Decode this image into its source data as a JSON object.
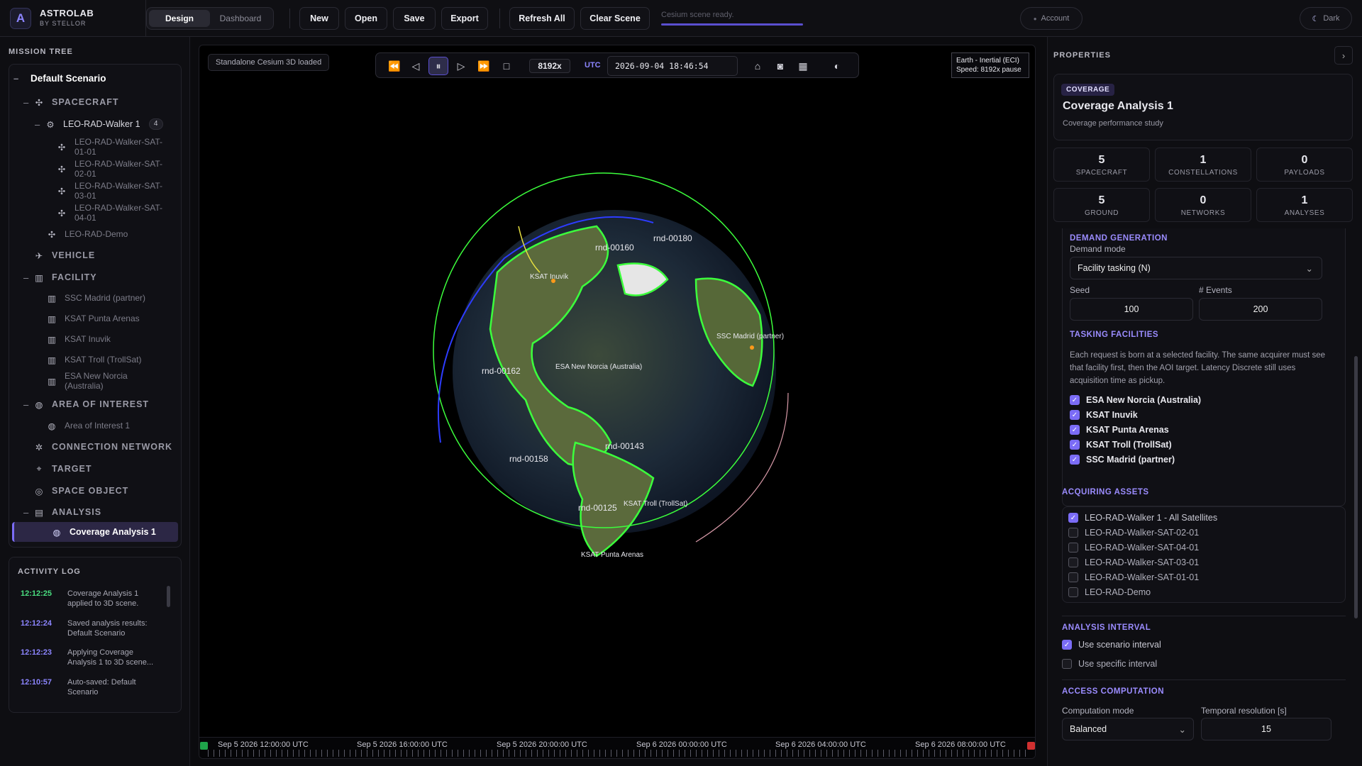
{
  "brand": {
    "name": "ASTROLAB",
    "sub": "BY STELLOR"
  },
  "mode_tabs": [
    "Design",
    "Dashboard"
  ],
  "toolbar": {
    "new": "New",
    "open": "Open",
    "save": "Save",
    "export": "Export",
    "refresh": "Refresh All",
    "clear": "Clear Scene",
    "status": "Cesium scene ready."
  },
  "account": "Account",
  "theme": "Dark",
  "mission_tree": {
    "title": "MISSION TREE",
    "root": "Default Scenario",
    "spacecraft": "SPACECRAFT",
    "walker": "LEO-RAD-Walker 1",
    "walker_count": "4",
    "sats": [
      "LEO-RAD-Walker-SAT-01-01",
      "LEO-RAD-Walker-SAT-02-01",
      "LEO-RAD-Walker-SAT-03-01",
      "LEO-RAD-Walker-SAT-04-01"
    ],
    "demo": "LEO-RAD-Demo",
    "vehicle": "VEHICLE",
    "facility": "FACILITY",
    "facilities": [
      "SSC Madrid (partner)",
      "KSAT Punta Arenas",
      "KSAT Inuvik",
      "KSAT Troll (TrollSat)",
      "ESA New Norcia (Australia)"
    ],
    "aoi": "AREA OF INTEREST",
    "aoi_item": "Area of Interest 1",
    "network": "CONNECTION NETWORK",
    "target": "TARGET",
    "space_object": "SPACE OBJECT",
    "analysis": "ANALYSIS",
    "analysis_item": "Coverage Analysis 1"
  },
  "activity_log": {
    "title": "ACTIVITY LOG",
    "entries": [
      {
        "time": "12:12:25",
        "msg": "Coverage Analysis 1 applied to 3D scene.",
        "color": "#4ade80"
      },
      {
        "time": "12:12:24",
        "msg": "Saved analysis results: Default Scenario",
        "color": "#8c85ff"
      },
      {
        "time": "12:12:23",
        "msg": "Applying Coverage Analysis 1 to 3D scene...",
        "color": "#8c85ff"
      },
      {
        "time": "12:10:57",
        "msg": "Auto-saved: Default Scenario",
        "color": "#8c85ff"
      }
    ]
  },
  "viewport": {
    "loaded": "Standalone Cesium 3D loaded",
    "speed": "8192x",
    "utc": "UTC",
    "time": "2026-09-04 18:46:54",
    "frame": "Earth - Inertial (ECI)",
    "speed_info": "Speed: 8192x pause",
    "globe_labels": [
      "rnd-00180",
      "rnd-00160",
      "KSAT Inuvik",
      "SSC Madrid (partner)",
      "rnd-00162",
      "ESA New Norcia (Australia)",
      "rnd-00143",
      "rnd-00158",
      "rnd-00125",
      "KSAT Troll (TrollSat)",
      "KSAT Punta Arenas"
    ],
    "timeline": [
      "Sep 5 2026 12:00:00 UTC",
      "Sep 5 2026 16:00:00 UTC",
      "Sep 5 2026 20:00:00 UTC",
      "Sep 6 2026 00:00:00 UTC",
      "Sep 6 2026 04:00:00 UTC",
      "Sep 6 2026 08:00:00 UTC"
    ]
  },
  "properties": {
    "title": "PROPERTIES",
    "chip": "COVERAGE",
    "name": "Coverage Analysis 1",
    "desc": "Coverage performance study",
    "stats": [
      {
        "n": "5",
        "l": "SPACECRAFT"
      },
      {
        "n": "1",
        "l": "CONSTELLATIONS"
      },
      {
        "n": "0",
        "l": "PAYLOADS"
      },
      {
        "n": "5",
        "l": "GROUND"
      },
      {
        "n": "0",
        "l": "NETWORKS"
      },
      {
        "n": "1",
        "l": "ANALYSES"
      }
    ],
    "demand_gen": "DEMAND GENERATION",
    "demand_mode_label": "Demand mode",
    "demand_mode": "Facility tasking (N)",
    "seed_label": "Seed",
    "seed": "100",
    "events_label": "# Events",
    "events": "200",
    "tasking_title": "TASKING FACILITIES",
    "tasking_desc": "Each request is born at a selected facility. The same acquirer must see that facility first, then the AOI target. Latency Discrete still uses acquisition time as pickup.",
    "tasking": [
      "ESA New Norcia (Australia)",
      "KSAT Inuvik",
      "KSAT Punta Arenas",
      "KSAT Troll (TrollSat)",
      "SSC Madrid (partner)"
    ],
    "acq_title": "ACQUIRING ASSETS",
    "acq": [
      {
        "label": "LEO-RAD-Walker 1 - All Satellites",
        "checked": true
      },
      {
        "label": "LEO-RAD-Walker-SAT-02-01",
        "checked": false
      },
      {
        "label": "LEO-RAD-Walker-SAT-04-01",
        "checked": false
      },
      {
        "label": "LEO-RAD-Walker-SAT-03-01",
        "checked": false
      },
      {
        "label": "LEO-RAD-Walker-SAT-01-01",
        "checked": false
      },
      {
        "label": "LEO-RAD-Demo",
        "checked": false
      }
    ],
    "interval_title": "ANALYSIS INTERVAL",
    "use_scenario": "Use scenario interval",
    "use_specific": "Use specific interval",
    "access_title": "ACCESS COMPUTATION",
    "comp_mode_label": "Computation mode",
    "comp_mode": "Balanced",
    "temporal_label": "Temporal resolution [s]",
    "temporal": "15"
  }
}
